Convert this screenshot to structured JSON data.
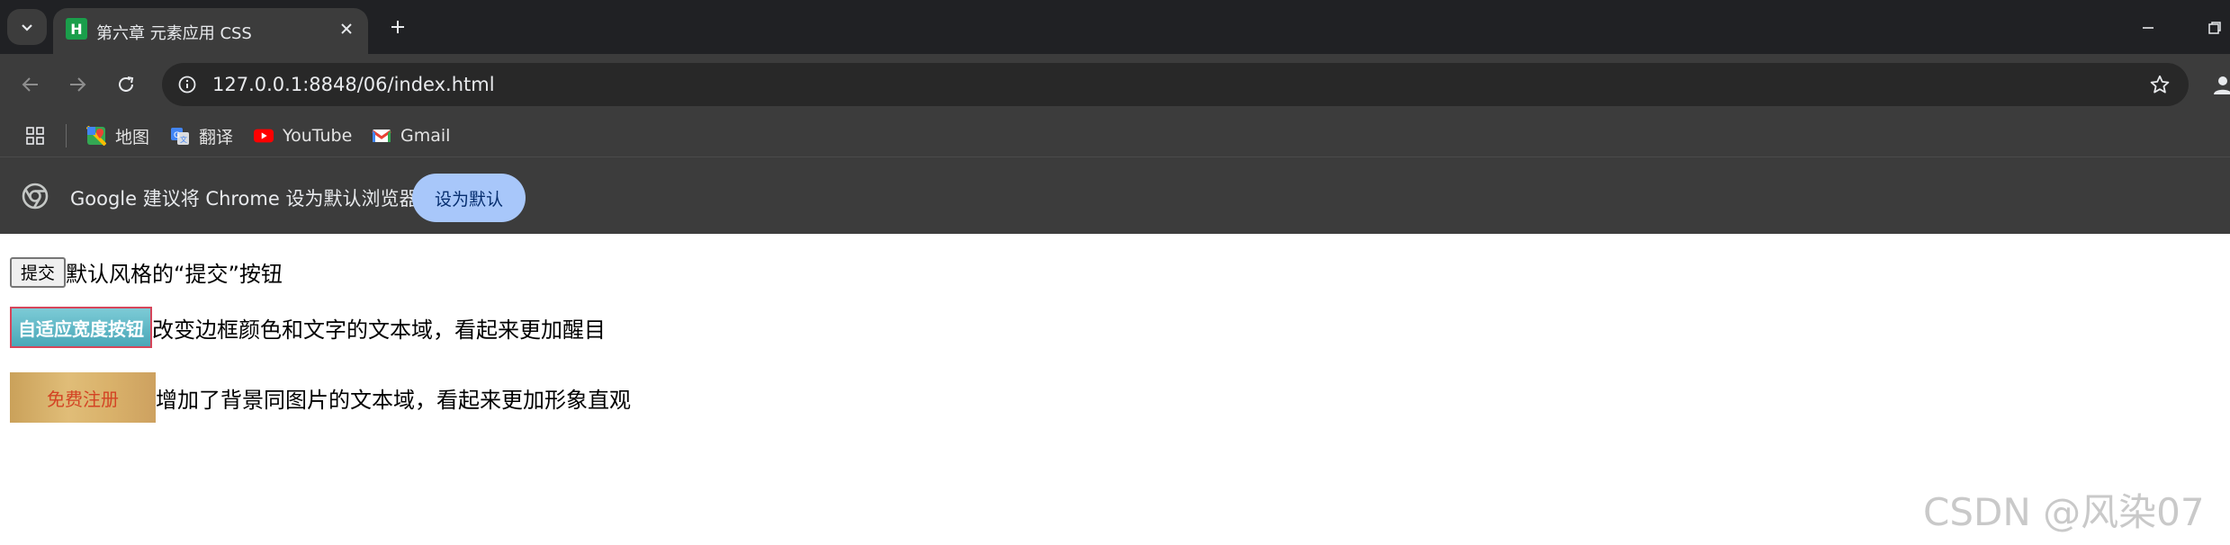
{
  "browser": {
    "tab": {
      "title": "第六章 元素应用 CSS",
      "favicon_letter": "H"
    },
    "address_bar": {
      "url": "127.0.0.1:8848/06/index.html"
    },
    "bookmarks": [
      {
        "label": "地图",
        "icon": "maps-icon"
      },
      {
        "label": "翻译",
        "icon": "translate-icon"
      },
      {
        "label": "YouTube",
        "icon": "youtube-icon"
      },
      {
        "label": "Gmail",
        "icon": "gmail-icon"
      }
    ],
    "infobar": {
      "message": "Google 建议将 Chrome 设为默认浏览器",
      "button_label": "设为默认"
    }
  },
  "page": {
    "rows": [
      {
        "button_label": "提交",
        "description": "默认风格的“提交”按钮"
      },
      {
        "button_label": "自适应宽度按钮",
        "description": "改变边框颜色和文字的文本域，看起来更加醒目"
      },
      {
        "button_label": "免费注册",
        "description": "增加了背景同图片的文本域，看起来更加形象直观"
      }
    ]
  },
  "watermark": "CSDN @风染07",
  "colors": {
    "tabstrip_bg": "#202124",
    "toolbar_bg": "#3c3c3c",
    "infobar_button": "#a8c7fa",
    "auto_button_border": "#d6455a",
    "register_text": "#d34424"
  }
}
